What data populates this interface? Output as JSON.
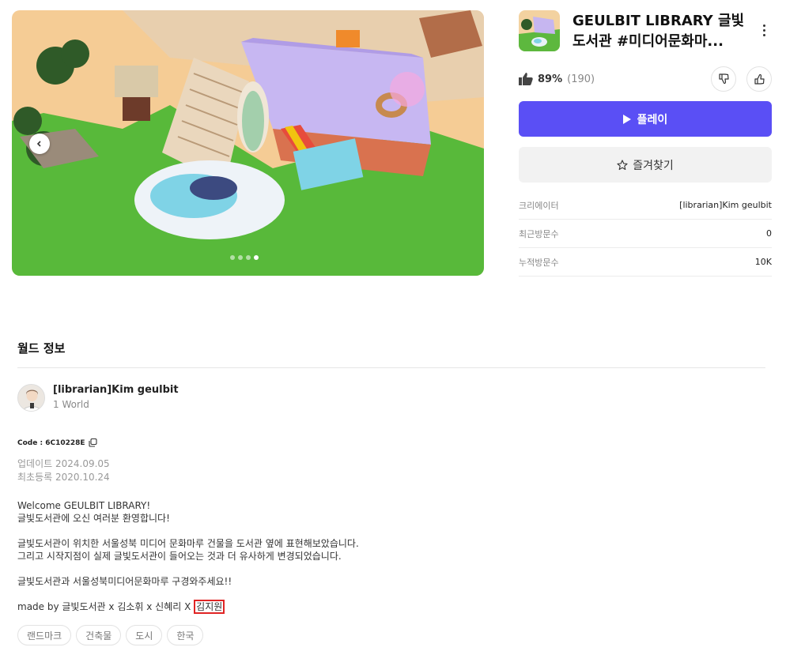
{
  "world": {
    "title_line1": "GEULBIT LIBRARY 글빛",
    "title_line2": "도서관 #미디어문화마...",
    "rating_percent": "89%",
    "rating_count": "(190)",
    "play_label": "플레이",
    "favorite_label": "즐겨찾기"
  },
  "carousel": {
    "slide_count": 4,
    "active_index": 3
  },
  "info": [
    {
      "label": "크리에이터",
      "value": "[librarian]Kim geulbit"
    },
    {
      "label": "최근방문수",
      "value": "0"
    },
    {
      "label": "누적방문수",
      "value": "10K"
    }
  ],
  "world_info": {
    "section_title": "월드 정보",
    "creator_name": "[librarian]Kim geulbit",
    "creator_worlds": "1 World",
    "code": "Code : 6C10228E",
    "updated": "업데이트 2024.09.05",
    "registered": "최초등록 2020.10.24",
    "desc": {
      "l1": "Welcome GEULBIT LIBRARY!",
      "l2": "글빛도서관에 오신 여러분 환영합니다!",
      "l3": "글빛도서관이 위치한 서울성북 미디어 문화마루 건물을 도서관 옆에 표현해보았습니다.",
      "l4": "그리고 시작지점이 실제 글빛도서관이 들어오는 것과 더 유사하게 변경되었습니다.",
      "l5": "글빛도서관과 서울성북미디어문화마루 구경와주세요!!",
      "l6_prefix": "made by 글빛도서관 x 김소휘 x 신혜리 X ",
      "l6_highlight": "김지원"
    },
    "tags": [
      "랜드마크",
      "건축물",
      "도시",
      "한국"
    ]
  },
  "colors": {
    "accent": "#5a4ff5",
    "highlight_border": "#e02424"
  }
}
